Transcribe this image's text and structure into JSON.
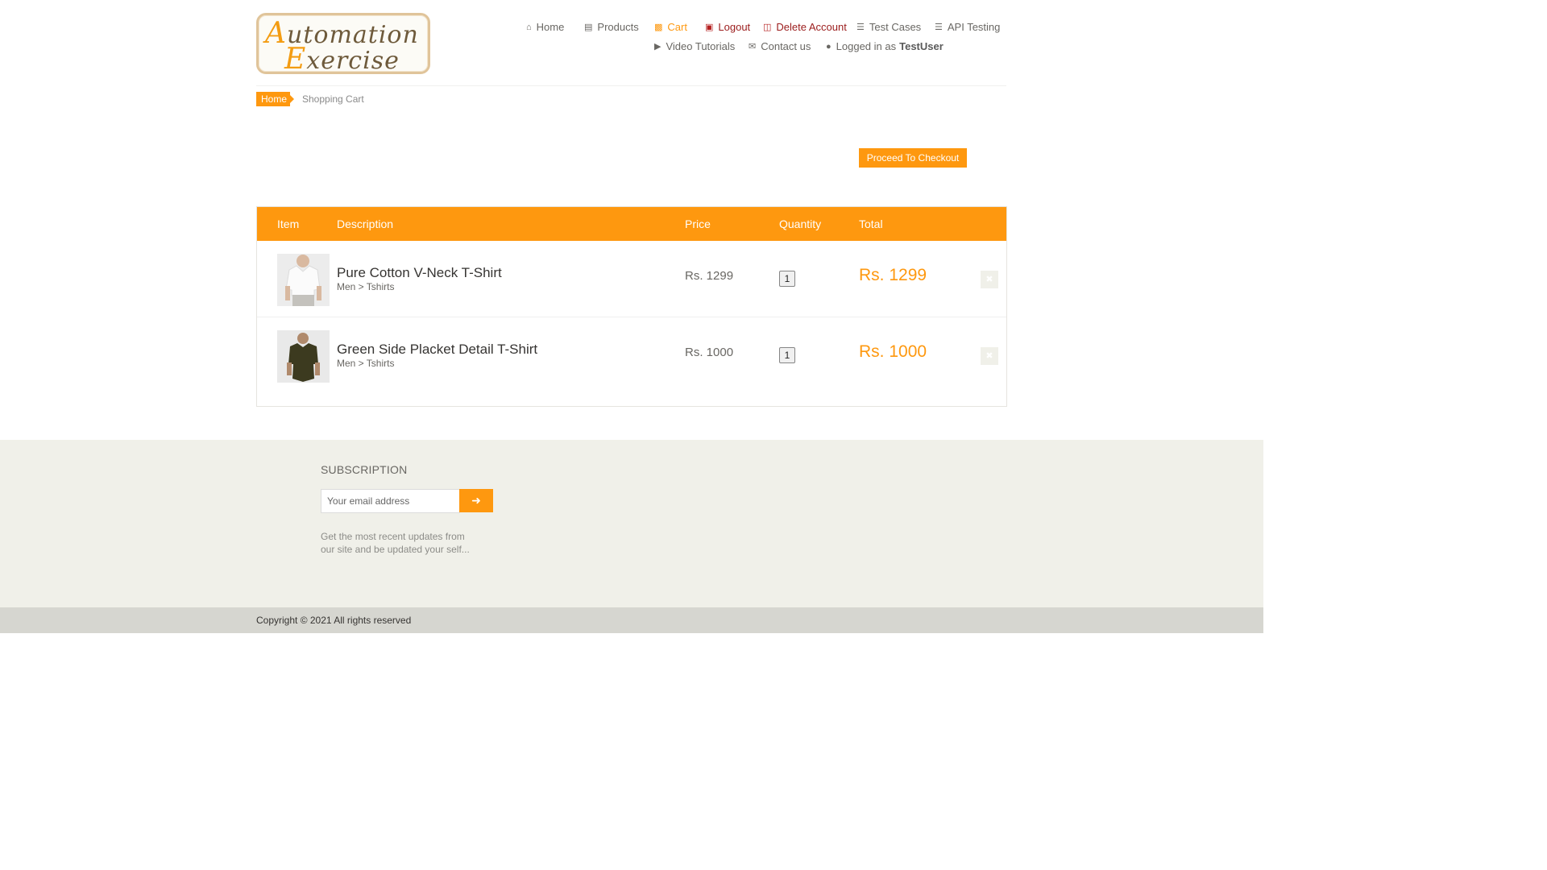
{
  "logo": {
    "line1_cap": "A",
    "line1_rest": "utomation",
    "line2_cap": "E",
    "line2_rest": "xercise"
  },
  "nav": {
    "home": "Home",
    "products": "Products",
    "cart": "Cart",
    "logout": "Logout",
    "delete_account": "Delete Account",
    "test_cases": "Test Cases",
    "api_testing": "API Testing",
    "video_tutorials": "Video Tutorials",
    "contact_us": "Contact us",
    "logged_in_prefix": "Logged in as",
    "logged_in_user": "TestUser"
  },
  "breadcrumb": {
    "home": "Home",
    "current": "Shopping Cart"
  },
  "checkout_button": "Proceed To Checkout",
  "table": {
    "headers": {
      "item": "Item",
      "description": "Description",
      "price": "Price",
      "quantity": "Quantity",
      "total": "Total"
    },
    "rows": [
      {
        "name": "Pure Cotton V-Neck T-Shirt",
        "category": "Men > Tshirts",
        "price": "Rs. 1299",
        "quantity": "1",
        "total": "Rs. 1299",
        "delete_icon": "close-icon"
      },
      {
        "name": "Green Side Placket Detail T-Shirt",
        "category": "Men > Tshirts",
        "price": "Rs. 1000",
        "quantity": "1",
        "total": "Rs. 1000",
        "delete_icon": "close-icon"
      }
    ]
  },
  "subscription": {
    "title": "SUBSCRIPTION",
    "placeholder": "Your email address",
    "description": "Get the most recent updates from our site and be updated your self..."
  },
  "footer": {
    "copyright": "Copyright © 2021 All rights reserved"
  },
  "colors": {
    "accent": "#fe980f",
    "danger": "#9b1c1c",
    "footer_bg": "#f0f0e9"
  }
}
